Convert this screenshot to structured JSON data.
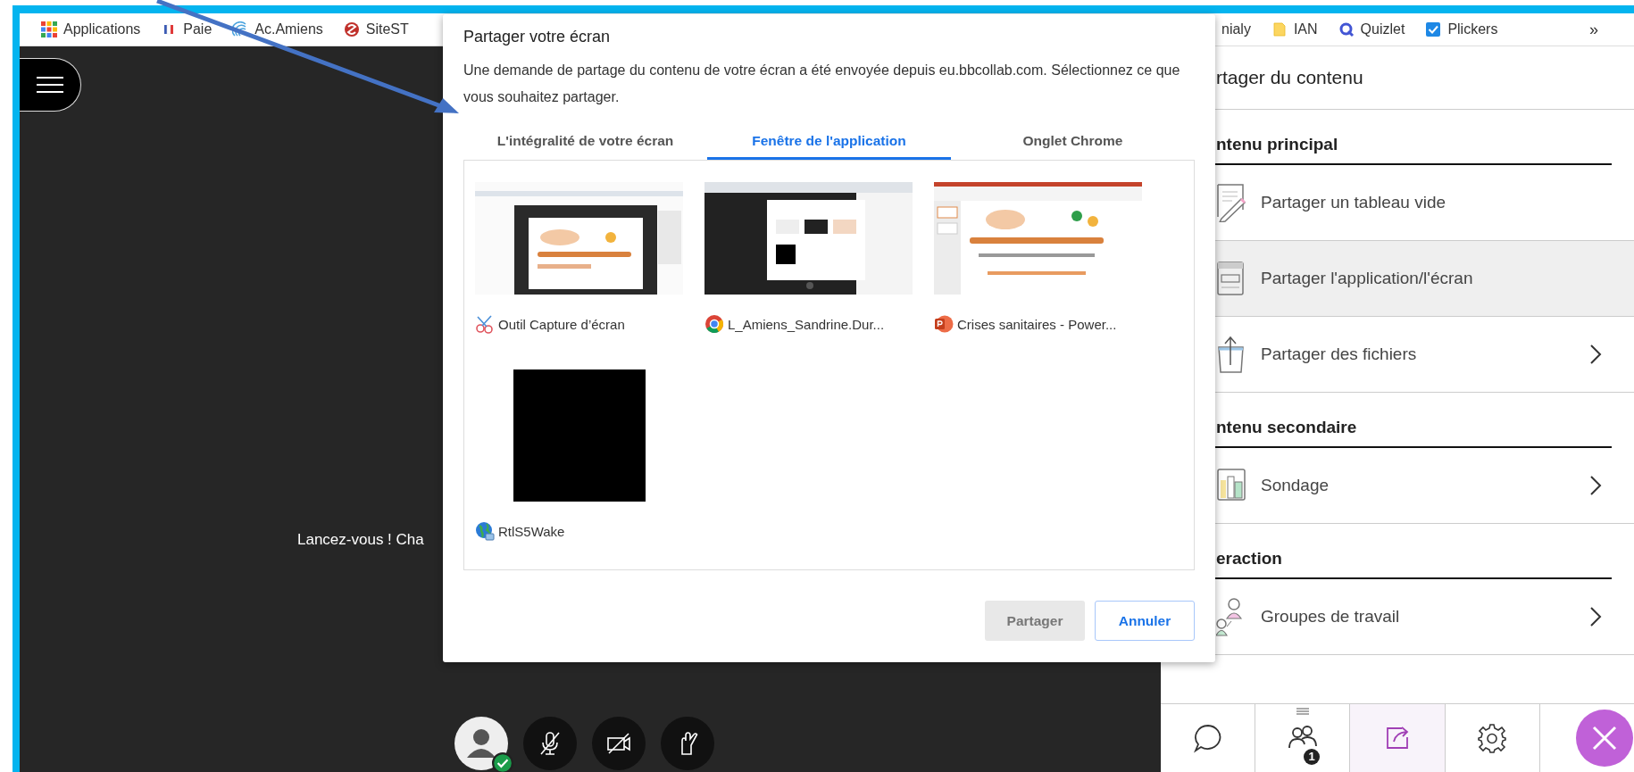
{
  "bookmarks_left": [
    {
      "label": "Applications",
      "kind": "apps"
    },
    {
      "label": "Paie",
      "kind": "flag"
    },
    {
      "label": "Ac.Amiens",
      "kind": "swirl"
    },
    {
      "label": "SiteST",
      "kind": "logo"
    }
  ],
  "bookmarks_right": [
    {
      "label": "nialy",
      "kind": "plain"
    },
    {
      "label": "IAN",
      "kind": "folder"
    },
    {
      "label": "Quizlet",
      "kind": "quiz"
    },
    {
      "label": "Plickers",
      "kind": "check"
    }
  ],
  "bookmarks_overflow": "»",
  "stage": {
    "message": "Lancez-vous ! Cha"
  },
  "controls": [
    {
      "kind": "avatar"
    },
    {
      "kind": "mic-off"
    },
    {
      "kind": "camera-off"
    },
    {
      "kind": "hand"
    }
  ],
  "dialog": {
    "title": "Partager votre écran",
    "description": "Une demande de partage du contenu de votre écran a été envoyée depuis eu.bbcollab.com. Sélectionnez ce que vous souhaitez partager.",
    "tabs": [
      {
        "label": "L'intégralité de votre écran",
        "selected": false
      },
      {
        "label": "Fenêtre de l'application",
        "selected": true
      },
      {
        "label": "Onglet Chrome",
        "selected": false
      }
    ],
    "sources": [
      {
        "label": "Outil Capture d’écran",
        "kind": "snipping"
      },
      {
        "label": "L_Amiens_Sandrine.Dur...",
        "kind": "browser"
      },
      {
        "label": "Crises sanitaires - Power...",
        "kind": "slides"
      },
      {
        "label": "RtlS5Wake",
        "kind": "blank"
      }
    ],
    "buttons": [
      {
        "label": "Partager",
        "kind": "primary",
        "disabled": true
      },
      {
        "label": "Annuler",
        "kind": "secondary",
        "disabled": false
      }
    ]
  },
  "panel": {
    "title": "rtager du contenu",
    "sections": [
      {
        "title": "ntenu principal",
        "items": [
          {
            "label": "Partager un tableau vide",
            "kind": "whiteboard",
            "selected": false,
            "chevron": false
          },
          {
            "label": "Partager l'application/l'écran",
            "kind": "window",
            "selected": true,
            "chevron": false
          },
          {
            "label": "Partager des fichiers",
            "kind": "file",
            "selected": false,
            "chevron": true
          }
        ]
      },
      {
        "title": "ntenu secondaire",
        "items": [
          {
            "label": "Sondage",
            "kind": "poll",
            "selected": false,
            "chevron": true
          }
        ]
      },
      {
        "title": "eraction",
        "items": [
          {
            "label": "Groupes de travail",
            "kind": "groups",
            "selected": false,
            "chevron": true
          }
        ]
      }
    ]
  },
  "toolbar": [
    {
      "kind": "chat",
      "selected": false
    },
    {
      "kind": "attendees",
      "selected": false,
      "badge": "1"
    },
    {
      "kind": "share",
      "selected": true
    },
    {
      "kind": "settings",
      "selected": false
    },
    {
      "kind": "close",
      "selected": false
    }
  ]
}
